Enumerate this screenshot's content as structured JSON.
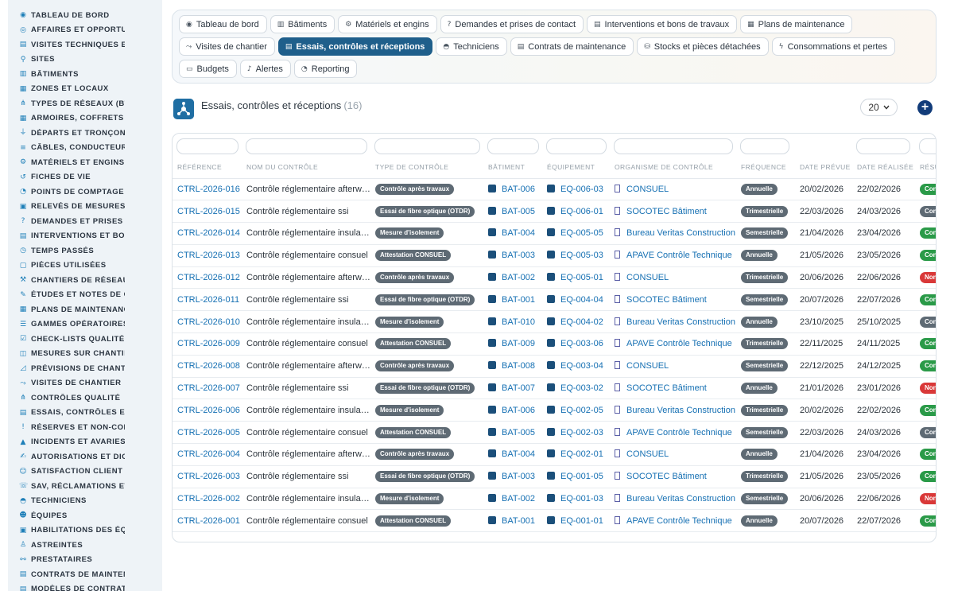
{
  "sidebar": {
    "items": [
      {
        "label": "TABLEAU DE BORD",
        "icon": "gauge-icon",
        "glyph": "◉"
      },
      {
        "label": "AFFAIRES ET OPPORTUNITÉS",
        "icon": "target-icon",
        "glyph": "◎"
      },
      {
        "label": "VISITES TECHNIQUES ET",
        "icon": "clipboard-icon",
        "glyph": "▤"
      },
      {
        "label": "SITES",
        "icon": "map-pin-icon",
        "glyph": "⚲"
      },
      {
        "label": "BÂTIMENTS",
        "icon": "building-icon",
        "glyph": "▥"
      },
      {
        "label": "ZONES ET LOCAUX",
        "icon": "layers-icon",
        "glyph": "▦"
      },
      {
        "label": "TYPES DE RÉSEAUX (BT / HTA)",
        "icon": "network-icon",
        "glyph": "⋔"
      },
      {
        "label": "ARMOIRES, COFFRETS ET TABLEAUX",
        "icon": "grid-icon",
        "glyph": "▦"
      },
      {
        "label": "DÉPARTS ET TRONÇONS",
        "icon": "plug-icon",
        "glyph": "⏚"
      },
      {
        "label": "CÂBLES, CONDUCTEURS",
        "icon": "cable-icon",
        "glyph": "≡"
      },
      {
        "label": "MATÉRIELS ET ENGINS",
        "icon": "gears-icon",
        "glyph": "⚙"
      },
      {
        "label": "FICHES DE VIE",
        "icon": "history-icon",
        "glyph": "↺"
      },
      {
        "label": "POINTS DE COMPTAGE ET MESURE",
        "icon": "counter-icon",
        "glyph": "◔"
      },
      {
        "label": "RELEVÉS DE MESURES",
        "icon": "readings-icon",
        "glyph": "▣"
      },
      {
        "label": "DEMANDES ET PRISES DE CONTACT",
        "icon": "question-icon",
        "glyph": "?"
      },
      {
        "label": "INTERVENTIONS ET BONS DE TRAVAUX",
        "icon": "work-order-icon",
        "glyph": "▤"
      },
      {
        "label": "TEMPS PASSÉS",
        "icon": "clock-icon",
        "glyph": "◷"
      },
      {
        "label": "PIÈCES UTILISÉES",
        "icon": "box-icon",
        "glyph": "▢"
      },
      {
        "label": "CHANTIERS DE RÉSEAUX",
        "icon": "hammer-icon",
        "glyph": "⚒"
      },
      {
        "label": "ÉTUDES ET NOTES DE CALCUL",
        "icon": "compass-icon",
        "glyph": "✎"
      },
      {
        "label": "PLANS DE MAINTENANCE",
        "icon": "calendar-icon",
        "glyph": "▦"
      },
      {
        "label": "GAMMES OPÉRATOIRES",
        "icon": "list-icon",
        "glyph": "☰"
      },
      {
        "label": "CHECK-LISTS QUALITÉ",
        "icon": "checklist-icon",
        "glyph": "☑"
      },
      {
        "label": "MESURES SUR CHANTIER",
        "icon": "ruler-icon",
        "glyph": "◫"
      },
      {
        "label": "PRÉVISIONS DE CHANTIER",
        "icon": "chart-icon",
        "glyph": "◿"
      },
      {
        "label": "VISITES DE CHANTIER",
        "icon": "route-icon",
        "glyph": "⤳"
      },
      {
        "label": "CONTRÔLES QUALITÉ",
        "icon": "sitemap-icon",
        "glyph": "⋔"
      },
      {
        "label": "ESSAIS, CONTRÔLES ET RÉCEPTIONS",
        "icon": "test-icon",
        "glyph": "▤"
      },
      {
        "label": "RÉSERVES ET NON-CONFORMITÉS",
        "icon": "warning-icon",
        "glyph": "!"
      },
      {
        "label": "INCIDENTS ET AVARIES",
        "icon": "alert-icon",
        "glyph": "▲"
      },
      {
        "label": "AUTORISATIONS ET DICT",
        "icon": "signature-icon",
        "glyph": "✍"
      },
      {
        "label": "SATISFACTION CLIENT",
        "icon": "smile-icon",
        "glyph": "☺"
      },
      {
        "label": "SAV, RÉCLAMATIONS ET GARANTIES",
        "icon": "headset-icon",
        "glyph": "☏"
      },
      {
        "label": "TECHNICIENS",
        "icon": "hardhat-icon",
        "glyph": "◓"
      },
      {
        "label": "ÉQUIPES",
        "icon": "users-icon",
        "glyph": "☻"
      },
      {
        "label": "HABILITATIONS DES ÉQUIPES",
        "icon": "id-badge-icon",
        "glyph": "▣"
      },
      {
        "label": "ASTREINTES",
        "icon": "person-icon",
        "glyph": "♙"
      },
      {
        "label": "PRESTATAIRES",
        "icon": "handshake-icon",
        "glyph": "⚯"
      },
      {
        "label": "CONTRATS DE MAINTENANCE",
        "icon": "contract-icon",
        "glyph": "▤"
      },
      {
        "label": "MODÈLES DE CONTRATS",
        "icon": "template-icon",
        "glyph": "▤"
      }
    ]
  },
  "tabs": [
    {
      "label": "Tableau de bord",
      "icon": "gauge-icon",
      "glyph": "◉",
      "active": false
    },
    {
      "label": "Bâtiments",
      "icon": "building-icon",
      "glyph": "▥",
      "active": false
    },
    {
      "label": "Matériels et engins",
      "icon": "gears-icon",
      "glyph": "⚙",
      "active": false
    },
    {
      "label": "Demandes et prises de contact",
      "icon": "question-icon",
      "glyph": "?",
      "active": false
    },
    {
      "label": "Interventions et bons de travaux",
      "icon": "work-order-icon",
      "glyph": "▤",
      "active": false
    },
    {
      "label": "Plans de maintenance",
      "icon": "calendar-icon",
      "glyph": "▦",
      "active": false
    },
    {
      "label": "Visites de chantier",
      "icon": "route-icon",
      "glyph": "⤳",
      "active": false
    },
    {
      "label": "Essais, contrôles et réceptions",
      "icon": "test-icon",
      "glyph": "▤",
      "active": true
    },
    {
      "label": "Techniciens",
      "icon": "hardhat-icon",
      "glyph": "◓",
      "active": false
    },
    {
      "label": "Contrats de maintenance",
      "icon": "contract-icon",
      "glyph": "▤",
      "active": false
    },
    {
      "label": "Stocks et pièces détachées",
      "icon": "boxes-icon",
      "glyph": "⛁",
      "active": false
    },
    {
      "label": "Consommations et pertes",
      "icon": "bolt-icon",
      "glyph": "ϟ",
      "active": false
    },
    {
      "label": "Budgets",
      "icon": "money-icon",
      "glyph": "▭",
      "active": false
    },
    {
      "label": "Alertes",
      "icon": "bell-icon",
      "glyph": "♪",
      "active": false
    },
    {
      "label": "Reporting",
      "icon": "pie-chart-icon",
      "glyph": "◔",
      "active": false
    }
  ],
  "header": {
    "title": "Essais, contrôles et réceptions",
    "count": "(16)",
    "page_size": "20",
    "add_icon": "plus-icon"
  },
  "table": {
    "columns": [
      "RÉFÉRENCE",
      "NOM DU CONTRÔLE",
      "TYPE DE CONTRÔLE",
      "BÂTIMENT",
      "ÉQUIPEMENT",
      "ORGANISME DE CONTRÔLE",
      "FRÉQUENCE",
      "DATE PRÉVUE",
      "DATE RÉALISÉE",
      "RÉSULTAT"
    ],
    "rows": [
      {
        "ref": "CTRL-2026-016",
        "name": "Contrôle réglementaire afterw…",
        "type": "Contrôle après travaux",
        "building": "BAT-006",
        "equipment": "EQ-006-03",
        "org": "CONSUEL",
        "freq": "Annuelle",
        "planned": "20/02/2026",
        "done": "22/02/2026",
        "result": "Conforme",
        "result_color": "#2a9a48"
      },
      {
        "ref": "CTRL-2026-015",
        "name": "Contrôle réglementaire ssi",
        "type": "Essai de fibre optique (OTDR)",
        "building": "BAT-005",
        "equipment": "EQ-006-01",
        "org": "SOCOTEC Bâtiment",
        "freq": "Trimestrielle",
        "planned": "22/03/2026",
        "done": "24/03/2026",
        "result": "Conforme avec réserves",
        "result_color": "#5e6a74"
      },
      {
        "ref": "CTRL-2026-014",
        "name": "Contrôle réglementaire insula…",
        "type": "Mesure d'isolement",
        "building": "BAT-004",
        "equipment": "EQ-005-05",
        "org": "Bureau Veritas Construction",
        "freq": "Semestrielle",
        "planned": "21/04/2026",
        "done": "23/04/2026",
        "result": "Conforme",
        "result_color": "#2a9a48"
      },
      {
        "ref": "CTRL-2026-013",
        "name": "Contrôle réglementaire consuel",
        "type": "Attestation CONSUEL",
        "building": "BAT-003",
        "equipment": "EQ-005-03",
        "org": "APAVE Contrôle Technique",
        "freq": "Annuelle",
        "planned": "21/05/2026",
        "done": "23/05/2026",
        "result": "Conforme",
        "result_color": "#2a9a48"
      },
      {
        "ref": "CTRL-2026-012",
        "name": "Contrôle réglementaire afterw…",
        "type": "Contrôle après travaux",
        "building": "BAT-002",
        "equipment": "EQ-005-01",
        "org": "CONSUEL",
        "freq": "Trimestrielle",
        "planned": "20/06/2026",
        "done": "22/06/2026",
        "result": "Non conforme",
        "result_color": "#d93838"
      },
      {
        "ref": "CTRL-2026-011",
        "name": "Contrôle réglementaire ssi",
        "type": "Essai de fibre optique (OTDR)",
        "building": "BAT-001",
        "equipment": "EQ-004-04",
        "org": "SOCOTEC Bâtiment",
        "freq": "Semestrielle",
        "planned": "20/07/2026",
        "done": "22/07/2026",
        "result": "Conforme",
        "result_color": "#2a9a48"
      },
      {
        "ref": "CTRL-2026-010",
        "name": "Contrôle réglementaire insula…",
        "type": "Mesure d'isolement",
        "building": "BAT-010",
        "equipment": "EQ-004-02",
        "org": "Bureau Veritas Construction",
        "freq": "Annuelle",
        "planned": "23/10/2025",
        "done": "25/10/2025",
        "result": "Conforme avec réserves",
        "result_color": "#5e6a74"
      },
      {
        "ref": "CTRL-2026-009",
        "name": "Contrôle réglementaire consuel",
        "type": "Attestation CONSUEL",
        "building": "BAT-009",
        "equipment": "EQ-003-06",
        "org": "APAVE Contrôle Technique",
        "freq": "Trimestrielle",
        "planned": "22/11/2025",
        "done": "24/11/2025",
        "result": "Conforme",
        "result_color": "#2a9a48"
      },
      {
        "ref": "CTRL-2026-008",
        "name": "Contrôle réglementaire afterw…",
        "type": "Contrôle après travaux",
        "building": "BAT-008",
        "equipment": "EQ-003-04",
        "org": "CONSUEL",
        "freq": "Semestrielle",
        "planned": "22/12/2025",
        "done": "24/12/2025",
        "result": "Conforme",
        "result_color": "#2a9a48"
      },
      {
        "ref": "CTRL-2026-007",
        "name": "Contrôle réglementaire ssi",
        "type": "Essai de fibre optique (OTDR)",
        "building": "BAT-007",
        "equipment": "EQ-003-02",
        "org": "SOCOTEC Bâtiment",
        "freq": "Annuelle",
        "planned": "21/01/2026",
        "done": "23/01/2026",
        "result": "Non conforme",
        "result_color": "#d93838"
      },
      {
        "ref": "CTRL-2026-006",
        "name": "Contrôle réglementaire insula…",
        "type": "Mesure d'isolement",
        "building": "BAT-006",
        "equipment": "EQ-002-05",
        "org": "Bureau Veritas Construction",
        "freq": "Trimestrielle",
        "planned": "20/02/2026",
        "done": "22/02/2026",
        "result": "Conforme",
        "result_color": "#2a9a48"
      },
      {
        "ref": "CTRL-2026-005",
        "name": "Contrôle réglementaire consuel",
        "type": "Attestation CONSUEL",
        "building": "BAT-005",
        "equipment": "EQ-002-03",
        "org": "APAVE Contrôle Technique",
        "freq": "Semestrielle",
        "planned": "22/03/2026",
        "done": "24/03/2026",
        "result": "Conforme avec réserves",
        "result_color": "#5e6a74"
      },
      {
        "ref": "CTRL-2026-004",
        "name": "Contrôle réglementaire afterw…",
        "type": "Contrôle après travaux",
        "building": "BAT-004",
        "equipment": "EQ-002-01",
        "org": "CONSUEL",
        "freq": "Annuelle",
        "planned": "21/04/2026",
        "done": "23/04/2026",
        "result": "Conforme",
        "result_color": "#2a9a48"
      },
      {
        "ref": "CTRL-2026-003",
        "name": "Contrôle réglementaire ssi",
        "type": "Essai de fibre optique (OTDR)",
        "building": "BAT-003",
        "equipment": "EQ-001-05",
        "org": "SOCOTEC Bâtiment",
        "freq": "Trimestrielle",
        "planned": "21/05/2026",
        "done": "23/05/2026",
        "result": "Conforme",
        "result_color": "#2a9a48"
      },
      {
        "ref": "CTRL-2026-002",
        "name": "Contrôle réglementaire insula…",
        "type": "Mesure d'isolement",
        "building": "BAT-002",
        "equipment": "EQ-001-03",
        "org": "Bureau Veritas Construction",
        "freq": "Semestrielle",
        "planned": "20/06/2026",
        "done": "22/06/2026",
        "result": "Non conforme",
        "result_color": "#d93838"
      },
      {
        "ref": "CTRL-2026-001",
        "name": "Contrôle réglementaire consuel",
        "type": "Attestation CONSUEL",
        "building": "BAT-001",
        "equipment": "EQ-001-01",
        "org": "APAVE Contrôle Technique",
        "freq": "Annuelle",
        "planned": "20/07/2026",
        "done": "22/07/2026",
        "result": "Conforme",
        "result_color": "#2a9a48"
      }
    ]
  }
}
